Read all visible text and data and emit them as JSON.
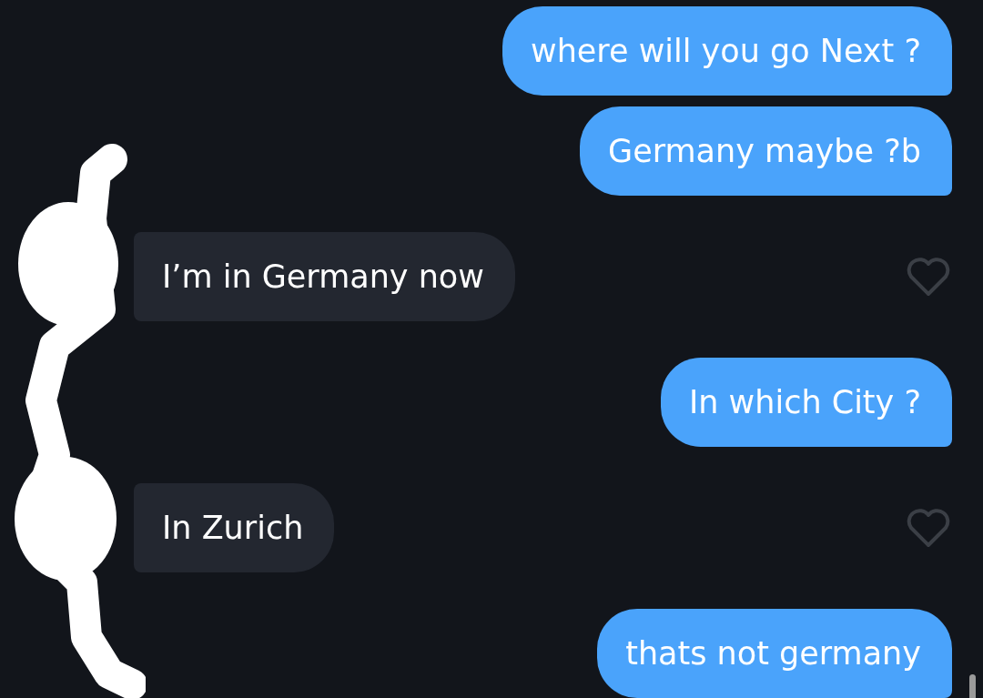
{
  "messages": [
    {
      "kind": "sent",
      "text": "where will you go Next ?"
    },
    {
      "kind": "sent",
      "text": "Germany maybe ?b"
    },
    {
      "kind": "received",
      "text": "I’m in Germany now",
      "liked": false
    },
    {
      "kind": "sent",
      "text": "In which City ?"
    },
    {
      "kind": "received",
      "text": "In Zurich",
      "liked": false
    },
    {
      "kind": "sent",
      "text": "thats not germany"
    }
  ]
}
